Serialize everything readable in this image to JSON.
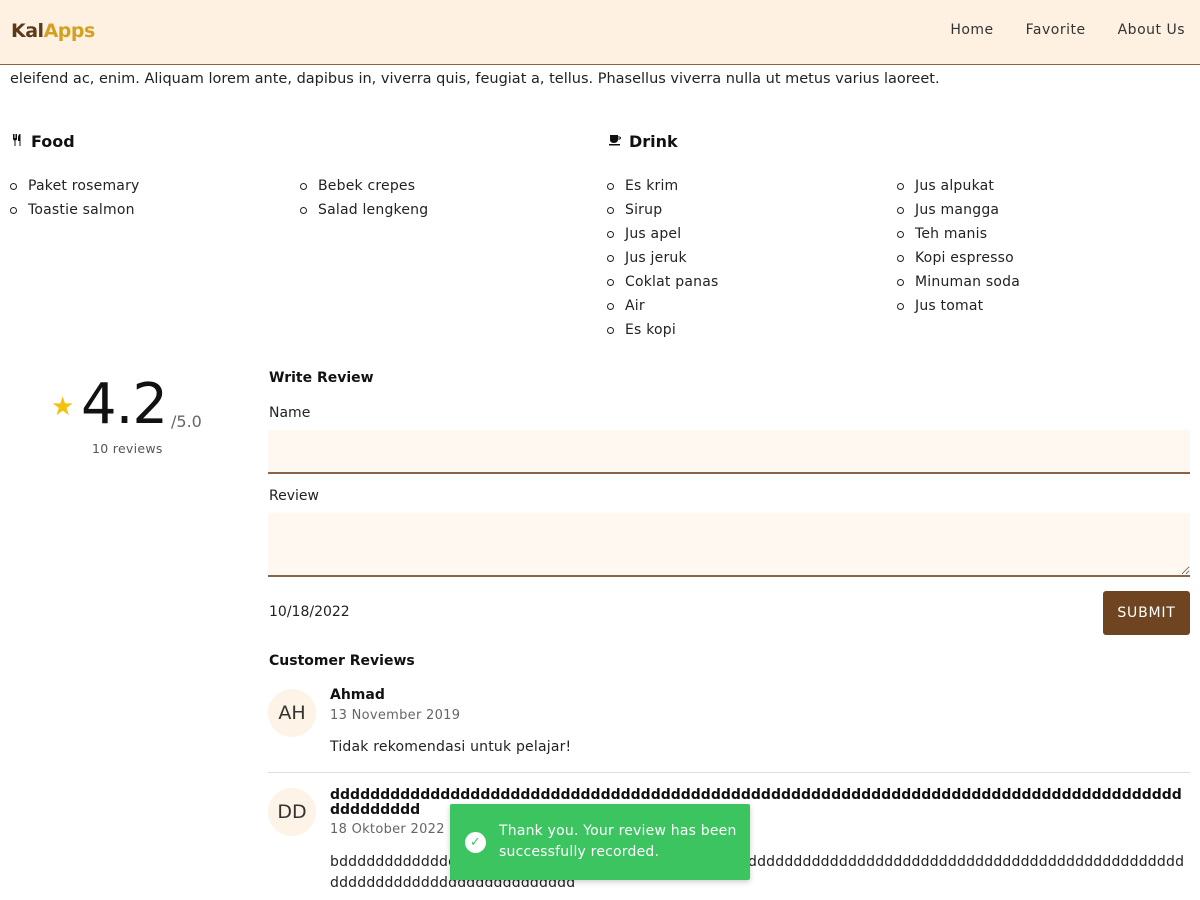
{
  "header": {
    "logo_part1": "Kal",
    "logo_part2": "Apps",
    "nav": [
      "Home",
      "Favorite",
      "About Us"
    ]
  },
  "intro_text": "eleifend ac, enim. Aliquam lorem ante, dapibus in, viverra quis, feugiat a, tellus. Phasellus viverra nulla ut metus varius laoreet.",
  "menu": {
    "food": {
      "title": "Food",
      "icon": "fork-knife-icon",
      "col1": [
        "Paket rosemary",
        "Toastie salmon"
      ],
      "col2": [
        "Bebek crepes",
        "Salad lengkeng"
      ]
    },
    "drink": {
      "title": "Drink",
      "icon": "cup-icon",
      "col1": [
        "Es krim",
        "Sirup",
        "Jus apel",
        "Jus jeruk",
        "Coklat panas",
        "Air",
        "Es kopi"
      ],
      "col2": [
        "Jus alpukat",
        "Jus mangga",
        "Teh manis",
        "Kopi espresso",
        "Minuman soda",
        "Jus tomat"
      ]
    }
  },
  "rating": {
    "score": "4.2",
    "max": "/5.0",
    "count": "10 reviews",
    "star_color": "#f4c20d"
  },
  "form": {
    "heading": "Write Review",
    "name_label": "Name",
    "name_value": "",
    "review_label": "Review",
    "review_value": "",
    "date": "10/18/2022",
    "submit_label": "SUBMIT"
  },
  "reviews": {
    "heading": "Customer Reviews",
    "items": [
      {
        "initials": "AH",
        "name": "Ahmad",
        "date": "13 November 2019",
        "text": "Tidak rekomendasi untuk pelajar!"
      },
      {
        "initials": "DD",
        "name": "dddddddddddddddddddddddddddddddddddddddddddddddddddddddddddddddddddddddddddddddddddddddddddddd",
        "date": "18 Oktober 2022",
        "text": "bdddddddddddddddddddddddddddddddddddddddddddddddddddddddddddddddddddddddddddddddddddddddddddddddddddddddddddddddddddddddd"
      }
    ]
  },
  "toast": {
    "message": "Thank you. Your review has been successfully recorded.",
    "color": "#3cc461"
  },
  "colors": {
    "header_bg": "#fff1e2",
    "accent_brown": "#6e4520",
    "logo_gold": "#d4a020"
  }
}
